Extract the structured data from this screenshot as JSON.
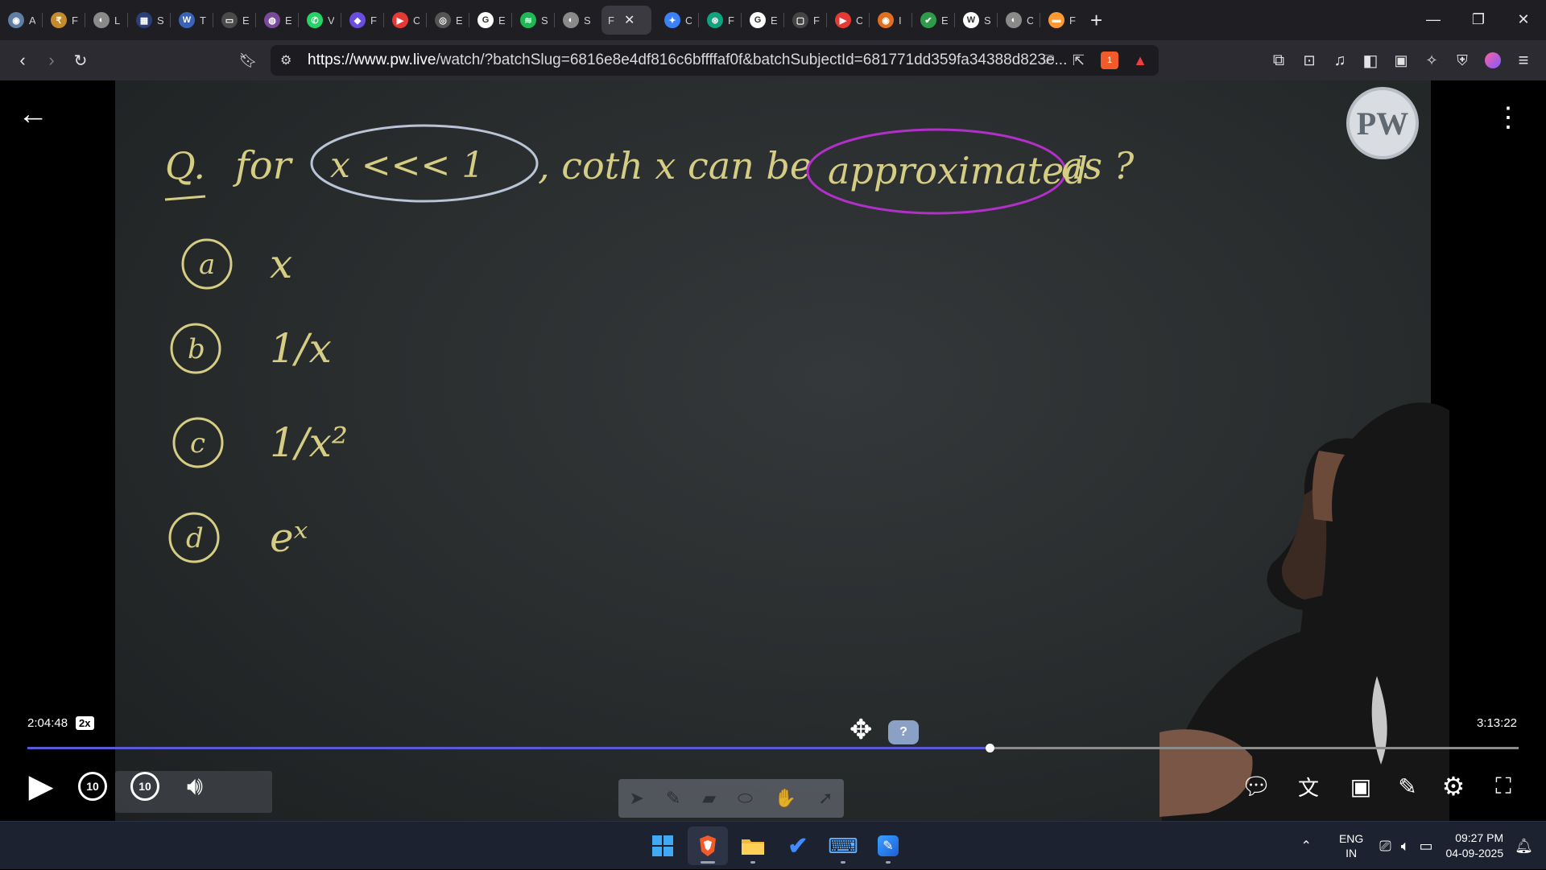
{
  "browser": {
    "tabs": [
      {
        "letter": "A",
        "color": "#5f7ea3",
        "glyph": "◉"
      },
      {
        "letter": "F",
        "color": "#c58a2c",
        "glyph": "₹"
      },
      {
        "letter": "L",
        "color": "#8a8a8a",
        "glyph": "◐"
      },
      {
        "letter": "S",
        "color": "#2b3e7a",
        "glyph": "▦"
      },
      {
        "letter": "T",
        "color": "#3a63b7",
        "glyph": "W"
      },
      {
        "letter": "E",
        "color": "#4a4a4a",
        "glyph": "▭"
      },
      {
        "letter": "E",
        "color": "#7a4a9a",
        "glyph": "◍"
      },
      {
        "letter": "V",
        "color": "#25d366",
        "glyph": "✆"
      },
      {
        "letter": "F",
        "color": "#6a4de0",
        "glyph": "◆"
      },
      {
        "letter": "C",
        "color": "#e53935",
        "glyph": "▶"
      },
      {
        "letter": "E",
        "color": "#555555",
        "glyph": "◎"
      },
      {
        "letter": "E",
        "color": "#ffffff",
        "glyph": "G"
      },
      {
        "letter": "S",
        "color": "#1db954",
        "glyph": "≋"
      },
      {
        "letter": "S",
        "color": "#8a8a8a",
        "glyph": "◐"
      },
      {
        "letter": "F",
        "color": "#3a3a40",
        "glyph": "",
        "active": true
      },
      {
        "letter": "C",
        "color": "#3b82f6",
        "glyph": "✦"
      },
      {
        "letter": "F",
        "color": "#10a37f",
        "glyph": "⊛"
      },
      {
        "letter": "E",
        "color": "#ffffff",
        "glyph": "G"
      },
      {
        "letter": "F",
        "color": "#444444",
        "glyph": "▢"
      },
      {
        "letter": "C",
        "color": "#e53935",
        "glyph": "▶"
      },
      {
        "letter": "I",
        "color": "#e07020",
        "glyph": "◉"
      },
      {
        "letter": "E",
        "color": "#2e9b4a",
        "glyph": "✔"
      },
      {
        "letter": "S",
        "color": "#ffffff",
        "glyph": "W"
      },
      {
        "letter": "C",
        "color": "#8a8a8a",
        "glyph": "◐"
      },
      {
        "letter": "F",
        "color": "#ff9933",
        "glyph": "▬"
      }
    ],
    "active_tab_letter": "F",
    "url_host": "https://www.pw.live",
    "url_rest": "/watch/?batchSlug=6816e8e4df816c6bffffaf0f&batchSubjectId=681771dd359fa34388d823e...",
    "brave_badge": "1"
  },
  "board": {
    "question_prefix": "Q.",
    "question_for": "for",
    "condition": "x <<< 1",
    "question_mid": ", coth x can be",
    "highlight": "approximated",
    "question_end": "as ?",
    "options": [
      {
        "label": "a",
        "value": "x"
      },
      {
        "label": "b",
        "value": "1/x"
      },
      {
        "label": "c",
        "value": "1/x²"
      },
      {
        "label": "d",
        "value": "eˣ"
      }
    ],
    "logo_text": "PW"
  },
  "player": {
    "current_time": "2:04:48",
    "speed": "2x",
    "duration": "3:13:22",
    "progress_fraction": 0.645,
    "skip_back_label": "10",
    "skip_forward_label": "10",
    "help_label": "?",
    "progress_color": "#5a59d6"
  },
  "taskbar": {
    "lang_top": "ENG",
    "lang_bottom": "IN",
    "time": "09:27 PM",
    "date": "04-09-2025"
  }
}
